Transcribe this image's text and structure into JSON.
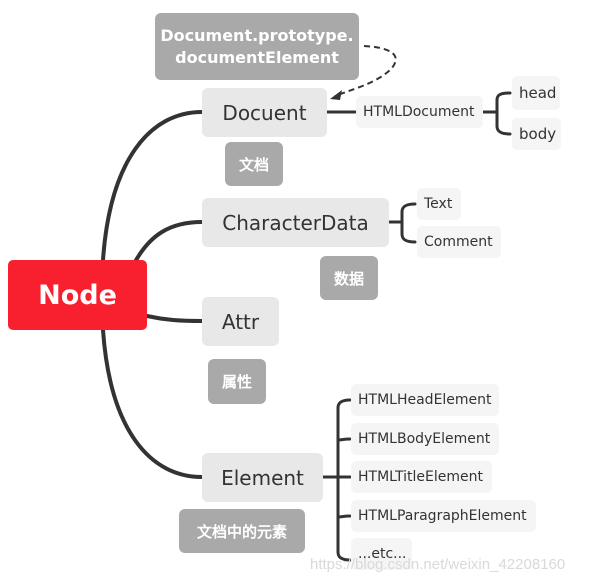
{
  "root": {
    "label": "Node",
    "color": "#f8202f"
  },
  "note_top": {
    "line1": "Document.prototype.",
    "line2": "documentElement"
  },
  "branches": {
    "document": {
      "label": "Docuent",
      "note": "文档",
      "child": "HTMLDocument",
      "grandchildren": [
        "head",
        "body"
      ]
    },
    "characterdata": {
      "label": "CharacterData",
      "note": "数据",
      "children": [
        "Text",
        "Comment"
      ]
    },
    "attr": {
      "label": "Attr",
      "note": "属性"
    },
    "element": {
      "label": "Element",
      "note": "文档中的元素",
      "children": [
        "HTMLHeadElement",
        "HTMLBodyElement",
        "HTMLTitleElement",
        "HTMLParagraphElement",
        "...etc..."
      ]
    }
  },
  "watermark": "https://blog.csdn.net/weixin_42208160"
}
